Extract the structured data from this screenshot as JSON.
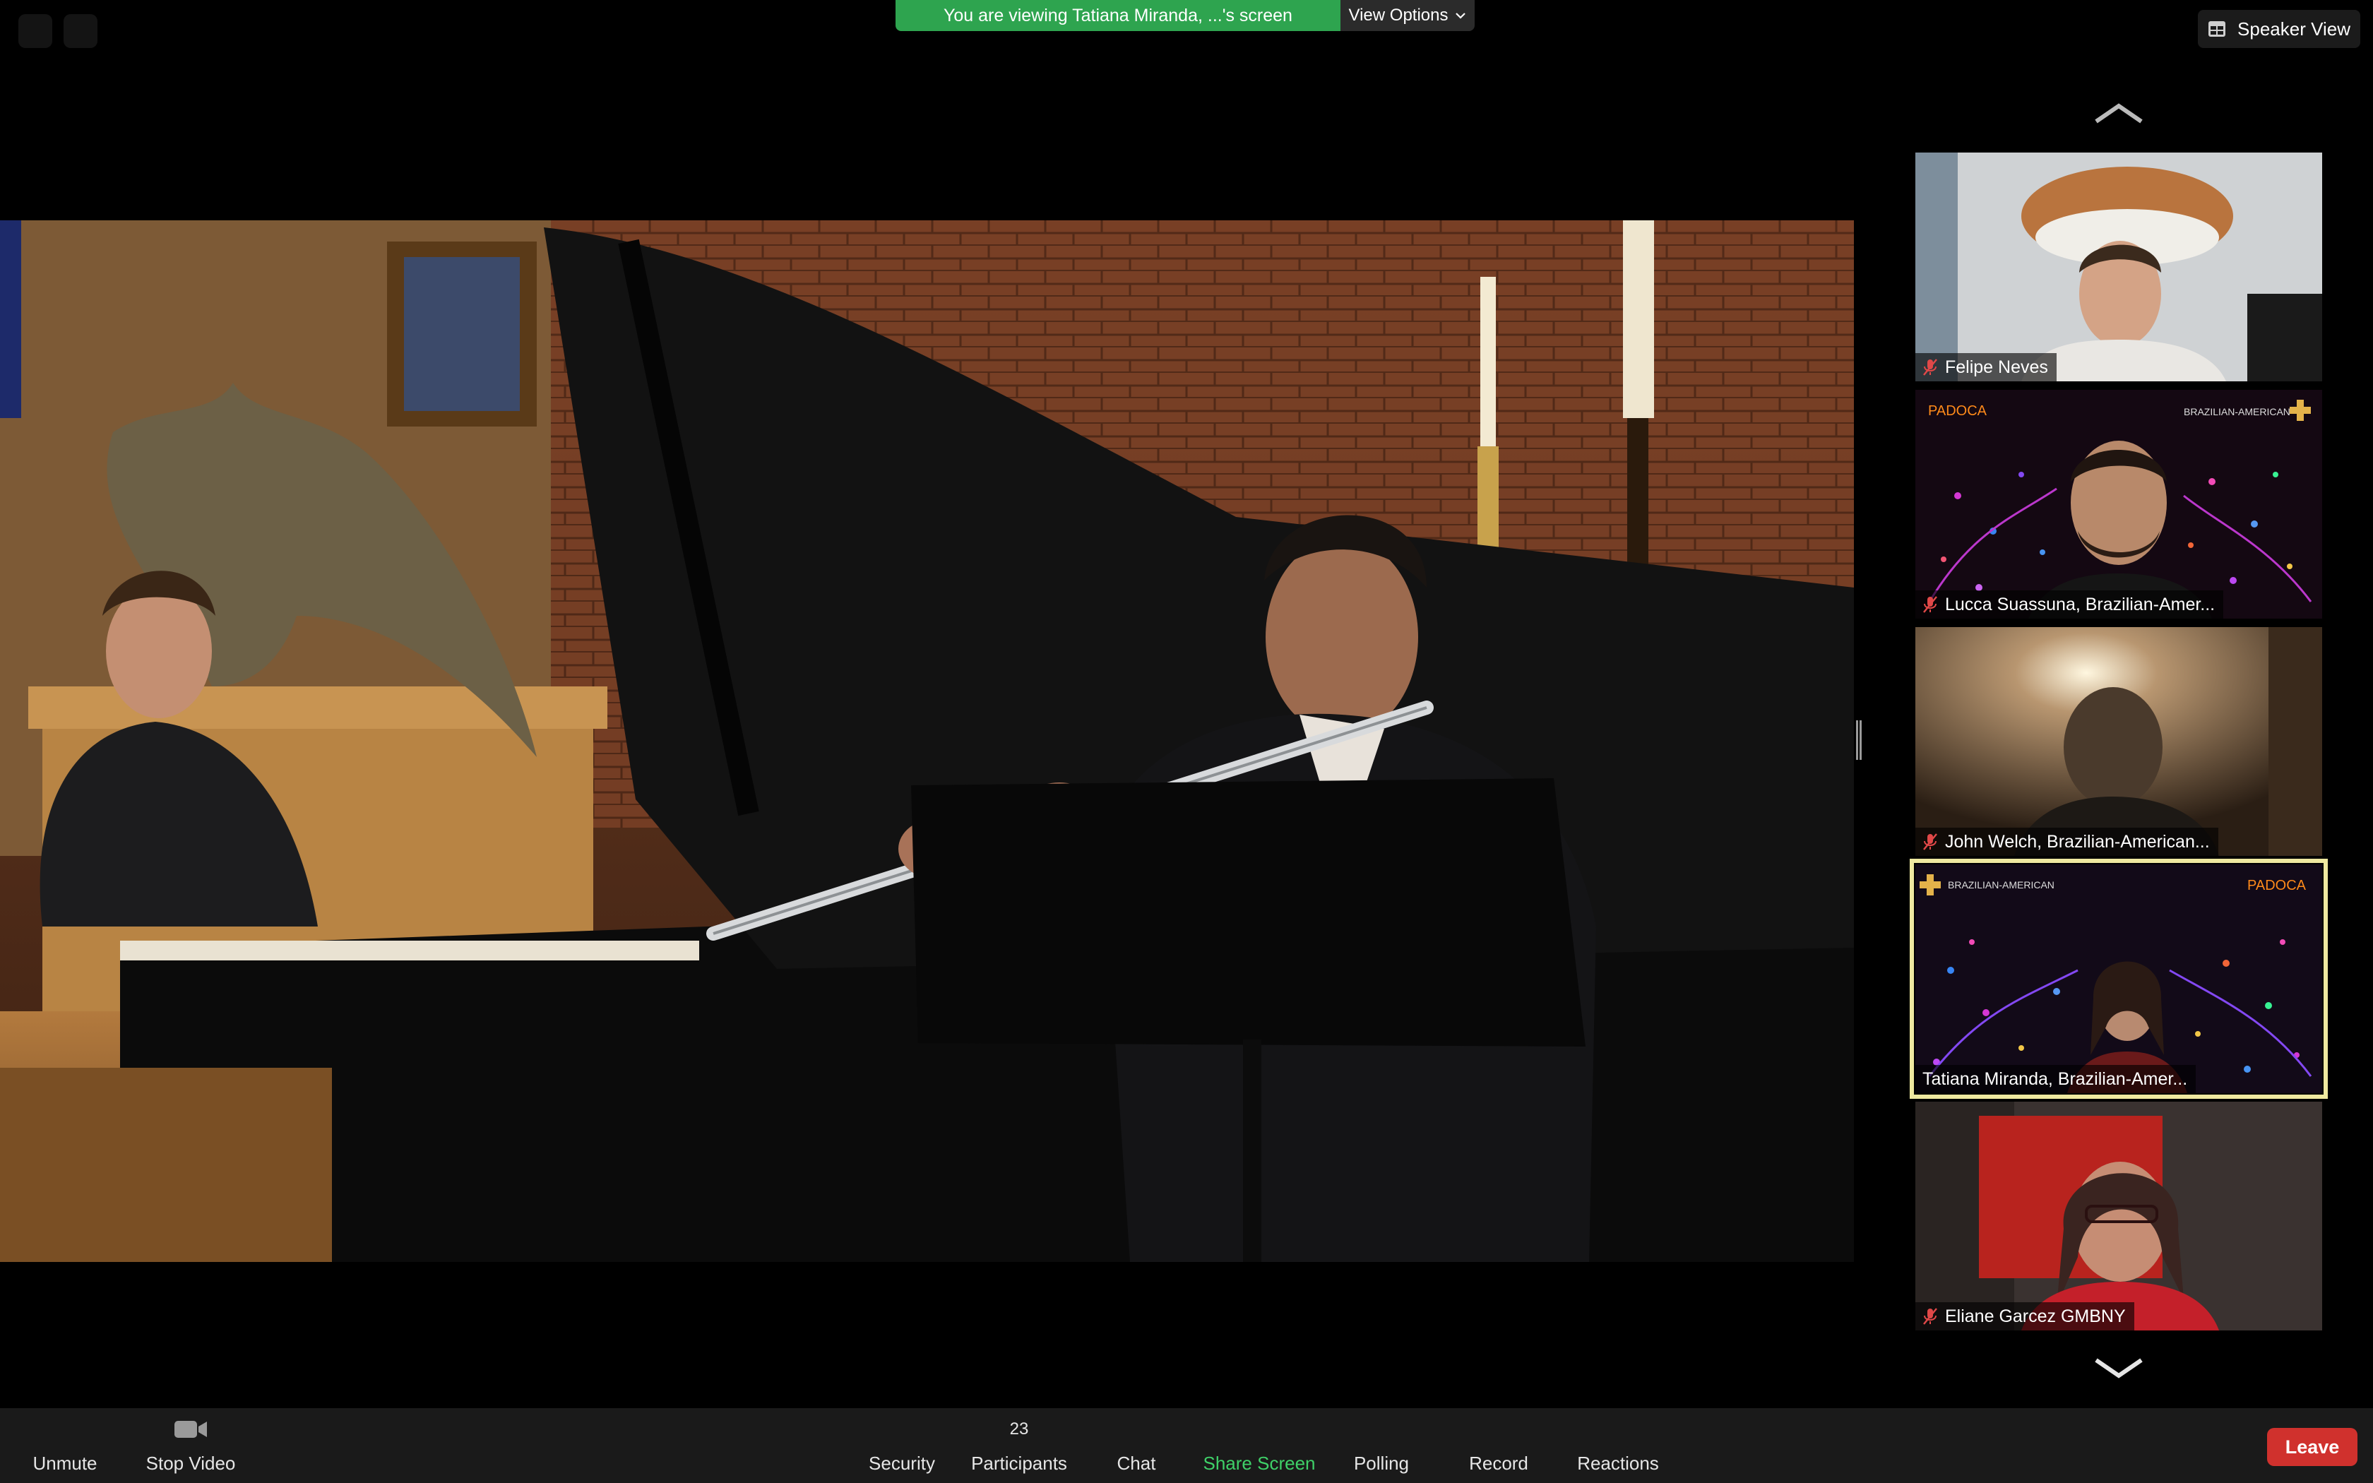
{
  "banner": {
    "message": "You are viewing Tatiana Miranda, ...'s screen",
    "view_options": "View Options"
  },
  "view_toggle": {
    "label": "Speaker View",
    "icon": "grid-icon"
  },
  "gallery": {
    "tiles": [
      {
        "name": "Felipe Neves",
        "muted": true,
        "active": false
      },
      {
        "name": "Lucca Suassuna, Brazilian-Amer...",
        "muted": true,
        "active": false
      },
      {
        "name": "John Welch, Brazilian-American...",
        "muted": true,
        "active": false
      },
      {
        "name": "Tatiana Miranda, Brazilian-Amer...",
        "muted": false,
        "active": true
      },
      {
        "name": "Eliane Garcez GMBNY",
        "muted": true,
        "active": false
      }
    ],
    "overlay_text": {
      "padoca": "PADOCA",
      "brazilian_american": "BRAZILIAN-AMERICAN"
    }
  },
  "toolbar": {
    "unmute": "Unmute",
    "stop_video": "Stop Video",
    "security": "Security",
    "participants": "Participants",
    "participants_count": "23",
    "chat": "Chat",
    "share_screen": "Share Screen",
    "polling": "Polling",
    "record": "Record",
    "reactions": "Reactions",
    "leave": "Leave"
  },
  "colors": {
    "banner_green": "#2ea44f",
    "share_green": "#3fd068",
    "leave_red": "#d0312d",
    "active_outline": "#efe9a0"
  }
}
